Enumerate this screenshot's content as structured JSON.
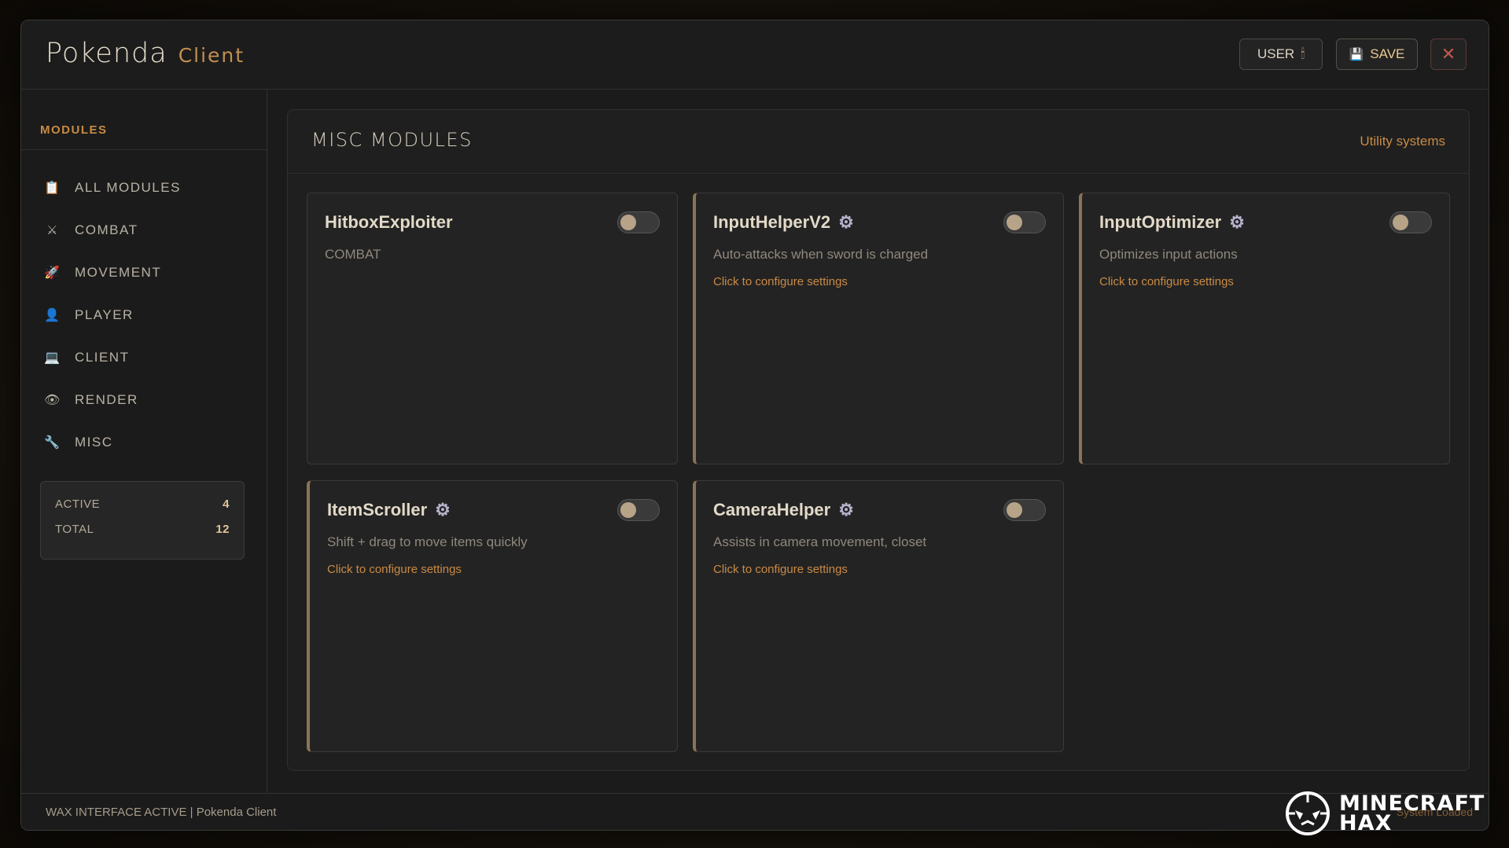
{
  "header": {
    "brand_name": "Pokenda",
    "brand_sub": "Client",
    "user_label": "USER",
    "save_label": "SAVE",
    "close_glyph": "✕"
  },
  "sidebar": {
    "title": "MODULES",
    "items": [
      {
        "label": "ALL MODULES",
        "icon": "clipboard-icon",
        "glyph": "📋"
      },
      {
        "label": "COMBAT",
        "icon": "crossed-swords-icon",
        "glyph": "⚔"
      },
      {
        "label": "MOVEMENT",
        "icon": "rocket-icon",
        "glyph": "🚀"
      },
      {
        "label": "PLAYER",
        "icon": "person-icon",
        "glyph": "👤"
      },
      {
        "label": "CLIENT",
        "icon": "laptop-icon",
        "glyph": "💻"
      },
      {
        "label": "RENDER",
        "icon": "eye-icon",
        "glyph": "👁"
      },
      {
        "label": "MISC",
        "icon": "wrench-icon",
        "glyph": "🔧"
      }
    ],
    "stats": {
      "active_label": "ACTIVE",
      "active_value": "4",
      "total_label": "TOTAL",
      "total_value": "12"
    }
  },
  "panel": {
    "title": "MISC MODULES",
    "subtitle": "Utility systems",
    "cards": [
      {
        "name": "HitboxExploiter",
        "desc": "COMBAT",
        "link": "",
        "enabled": false,
        "gear": false
      },
      {
        "name": "InputHelperV2",
        "desc": "Auto-attacks when sword is charged",
        "link": "Click to configure settings",
        "enabled": false,
        "gear": true
      },
      {
        "name": "InputOptimizer",
        "desc": "Optimizes input actions",
        "link": "Click to configure settings",
        "enabled": false,
        "gear": true
      },
      {
        "name": "ItemScroller",
        "desc": "Shift + drag to move items quickly",
        "link": "Click to configure settings",
        "enabled": false,
        "gear": true
      },
      {
        "name": "CameraHelper",
        "desc": "Assists in camera movement, closet",
        "link": "Click to configure settings",
        "enabled": false,
        "gear": true
      }
    ]
  },
  "footer": {
    "status": "WAX INTERFACE ACTIVE | Pokenda Client",
    "right": "System Loaded"
  },
  "watermark": {
    "line1": "MINECRAFT",
    "line2": "HAX"
  },
  "colors": {
    "accent": "#c98a45",
    "background": "#1b1b1b"
  }
}
